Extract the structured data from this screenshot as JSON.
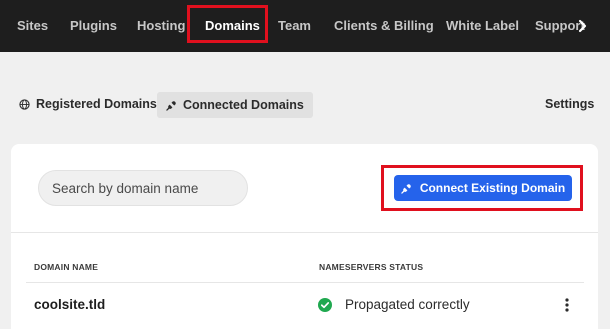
{
  "topnav": {
    "items": [
      {
        "label": "Sites",
        "active": false
      },
      {
        "label": "Plugins",
        "active": false
      },
      {
        "label": "Hosting",
        "active": false
      },
      {
        "label": "Domains",
        "active": true
      },
      {
        "label": "Team",
        "active": false
      },
      {
        "label": "Clients & Billing",
        "active": false
      },
      {
        "label": "White Label",
        "active": false
      },
      {
        "label": "Support",
        "active": false
      }
    ],
    "overflow_icon": "chevron-right-icon"
  },
  "subnav": {
    "registered": {
      "label": "Registered Domains",
      "icon": "globe-icon"
    },
    "connected": {
      "label": "Connected Domains",
      "icon": "plug-icon",
      "active": true
    },
    "settings": {
      "label": "Settings"
    }
  },
  "search": {
    "placeholder": "Search by domain name",
    "value": ""
  },
  "connect_button": {
    "label": "Connect Existing Domain",
    "icon": "plug-icon"
  },
  "table": {
    "columns": [
      "DOMAIN NAME",
      "NAMESERVERS STATUS"
    ],
    "rows": [
      {
        "domain": "coolsite.tld",
        "status": "Propagated correctly",
        "status_icon": "check-circle-icon"
      }
    ]
  },
  "colors": {
    "nav_bg": "#1e1e1e",
    "accent_blue": "#2563eb",
    "highlight_red": "#e0101e",
    "success_green": "#1fa84f"
  }
}
